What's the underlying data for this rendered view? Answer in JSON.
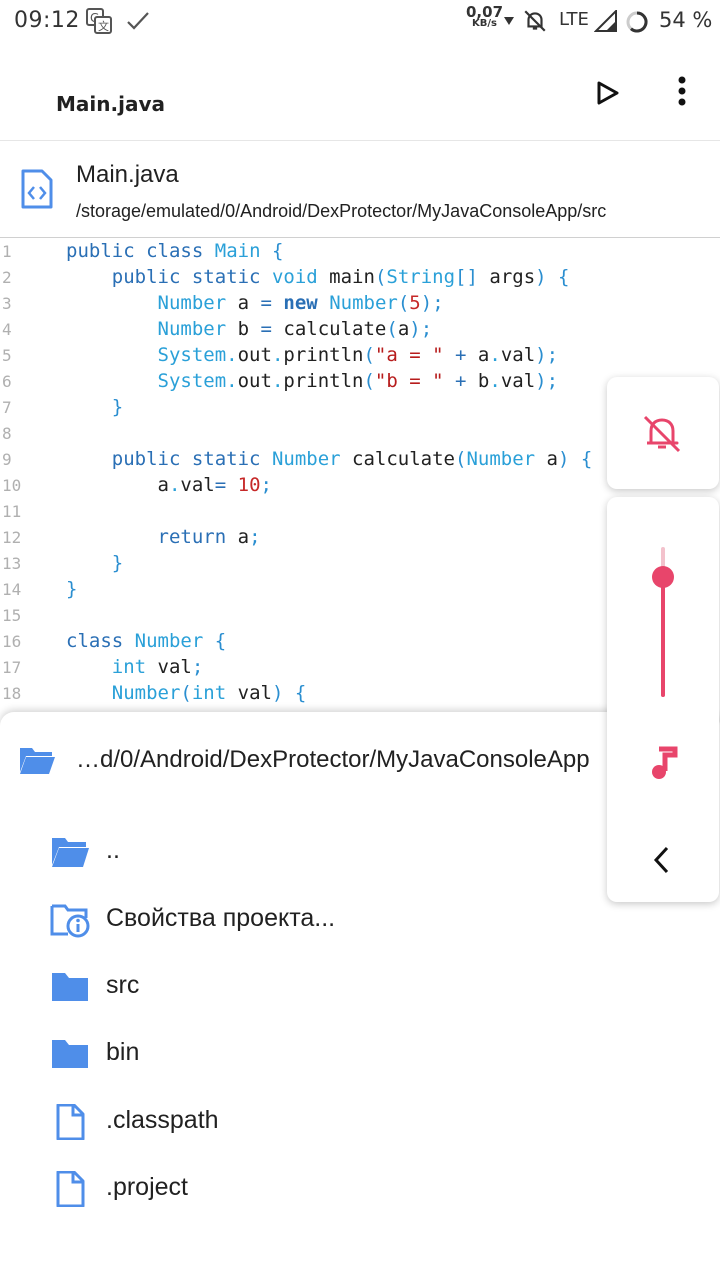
{
  "status_bar": {
    "time": "09:12",
    "net_speed_value": "0,07",
    "net_speed_unit": "KB/s",
    "network": "LTE",
    "battery": "54 %"
  },
  "toolbar": {
    "title": "Main.java"
  },
  "file_header": {
    "name": "Main.java",
    "path": "/storage/emulated/0/Android/DexProtector/MyJavaConsoleApp/src"
  },
  "code": {
    "lines": [
      {
        "n": "1"
      },
      {
        "n": "2"
      },
      {
        "n": "3"
      },
      {
        "n": "4"
      },
      {
        "n": "5"
      },
      {
        "n": "6"
      },
      {
        "n": "7"
      },
      {
        "n": "8"
      },
      {
        "n": "9"
      },
      {
        "n": "10"
      },
      {
        "n": "11"
      },
      {
        "n": "12"
      },
      {
        "n": "13"
      },
      {
        "n": "14"
      },
      {
        "n": "15"
      },
      {
        "n": "16"
      },
      {
        "n": "17"
      },
      {
        "n": "18"
      }
    ],
    "t": {
      "public": "public",
      "class": "class",
      "Main": "Main",
      "lbrace": "{",
      "rbrace": "}",
      "static": "static",
      "void": "void",
      "main": "main",
      "lparen": "(",
      "rparen": ")",
      "String": "String",
      "brackets": "[]",
      "args": "args",
      "Number": "Number",
      "a": "a",
      "b": "b",
      "eq": "=",
      "new": "new",
      "five": "5",
      "semi": ";",
      "calculate": "calculate",
      "System": "System",
      "dot": ".",
      "out": "out",
      "println": "println",
      "str_a": "\"a = \"",
      "str_b": "\"b = \"",
      "plus": "+",
      "val": "val",
      "eq2": "=",
      "ten": "10",
      "return": "return",
      "int": "int"
    }
  },
  "sheet": {
    "path": "…d/0/Android/DexProtector/MyJavaConsoleApp",
    "items": [
      {
        "label": ".."
      },
      {
        "label": "Свойства проекта..."
      },
      {
        "label": "src"
      },
      {
        "label": "bin"
      },
      {
        "label": ".classpath"
      },
      {
        "label": ".project"
      }
    ]
  },
  "volume": {
    "level": 0.8
  },
  "colors": {
    "accent": "#e8456b",
    "folder": "#4f8ee9",
    "keyword": "#2a6fb5",
    "type": "#2aa0d8",
    "number": "#c62828"
  },
  "icons": {
    "run": "play-icon",
    "more": "more-vert-icon",
    "file": "code-file-icon",
    "mute": "bell-off-icon",
    "music": "music-note-icon",
    "collapse": "chevron-left-icon"
  }
}
